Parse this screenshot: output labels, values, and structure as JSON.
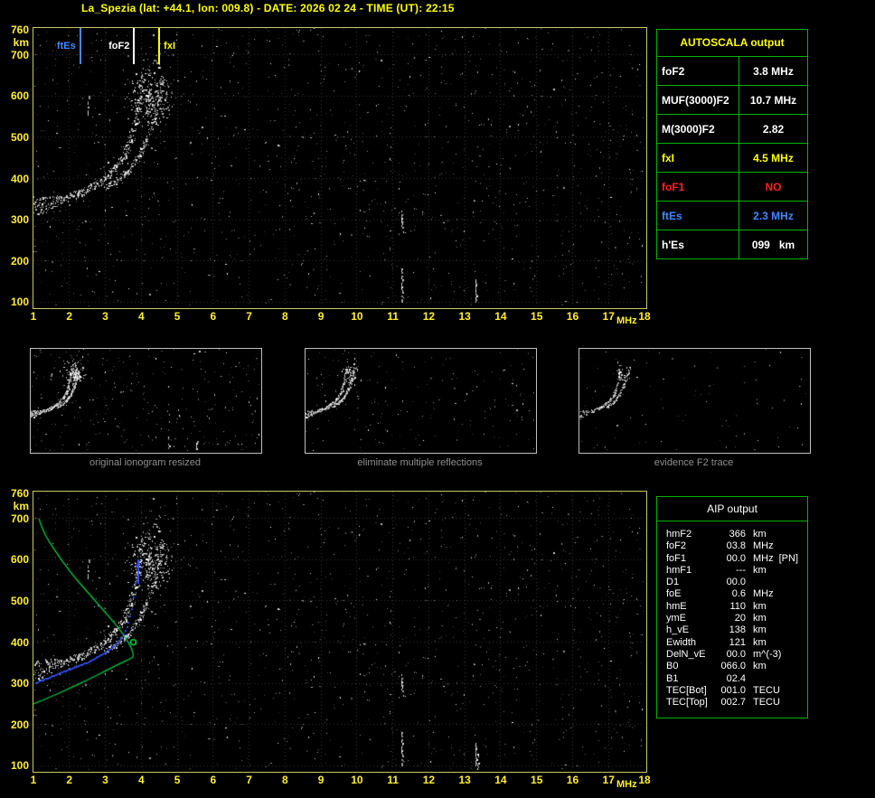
{
  "header": {
    "title": "La_Spezia (lat: +44.1, lon: 009.8) - DATE: 2026 02 24 - TIME (UT): 22:15"
  },
  "colors": {
    "title_text": "#ffff00",
    "plot_border": "#c9c960",
    "axis_text": "#ffee33",
    "grid": "#3a3a3a",
    "panel_border": "#00b400",
    "autoscala_header": "#ffff00",
    "caption_text": "#8f8f8f",
    "profile_green": "#00cc44",
    "restored_blue": "#2e4be8",
    "hmF2_marker_green": "#00ff55",
    "foF2_tick_blue": "#3355ff"
  },
  "autoscala": {
    "header": "AUTOSCALA output",
    "rows": [
      {
        "label": "foF2",
        "value": "3.8 MHz",
        "color": "#ffffff"
      },
      {
        "label": "MUF(3000)F2",
        "value": "10.7 MHz",
        "color": "#ffffff"
      },
      {
        "label": "M(3000)F2",
        "value": "2.82",
        "color": "#ffffff"
      },
      {
        "label": "fxI",
        "value": "4.5 MHz",
        "color": "#ffff00"
      },
      {
        "label": "foF1",
        "value": "NO",
        "color": "#ff2222"
      },
      {
        "label": "ftEs",
        "value": "2.3 MHz",
        "color": "#4488ff"
      },
      {
        "label": "h'Es",
        "value": "099   km",
        "color": "#ffffff"
      }
    ]
  },
  "thumbnails": [
    {
      "caption": "original ionogram resized"
    },
    {
      "caption": "eliminate multiple reflections"
    },
    {
      "caption": "evidence F2 trace"
    }
  ],
  "aip": {
    "header": "AIP output",
    "rows": [
      {
        "label": "hmF2",
        "value": "366",
        "unit": "km",
        "extra": ""
      },
      {
        "label": "foF2",
        "value": "03.8",
        "unit": "MHz",
        "extra": ""
      },
      {
        "label": "foF1",
        "value": "00.0",
        "unit": "MHz",
        "extra": "[PN]"
      },
      {
        "label": "hmF1",
        "value": "---",
        "unit": "km",
        "extra": ""
      },
      {
        "label": "D1",
        "value": "00.0",
        "unit": "",
        "extra": ""
      },
      {
        "label": "foE",
        "value": "0.6",
        "unit": "MHz",
        "extra": ""
      },
      {
        "label": "hmE",
        "value": "110",
        "unit": "km",
        "extra": ""
      },
      {
        "label": "ymE",
        "value": "20",
        "unit": "km",
        "extra": ""
      },
      {
        "label": "h_vE",
        "value": "138",
        "unit": "km",
        "extra": ""
      },
      {
        "label": "Ewidth",
        "value": "121",
        "unit": "km",
        "extra": ""
      },
      {
        "label": "DelN_vE",
        "value": "00.0",
        "unit": "m^(-3)",
        "extra": ""
      },
      {
        "label": "B0",
        "value": "066.0",
        "unit": "km",
        "extra": ""
      },
      {
        "label": "B1",
        "value": "02.4",
        "unit": "",
        "extra": ""
      },
      {
        "label": "TEC[Bot]",
        "value": "001.0",
        "unit": "TECU",
        "extra": ""
      },
      {
        "label": "TEC[Top]",
        "value": "002.7",
        "unit": "TECU",
        "extra": ""
      }
    ]
  },
  "chart_data": {
    "type": "scatter",
    "title": "Ionogram La_Spezia 2026-02-24 22:15 UT",
    "xlabel": "MHz",
    "ylabel": "km",
    "xlim": [
      1,
      18
    ],
    "ylim": [
      90,
      765
    ],
    "grid": true,
    "x_ticks": [
      1,
      2,
      3,
      4,
      5,
      6,
      7,
      8,
      9,
      10,
      11,
      12,
      13,
      14,
      15,
      16,
      17,
      18
    ],
    "y_ticks": [
      760,
      700,
      600,
      500,
      400,
      300,
      200,
      100
    ],
    "markers": [
      {
        "label": "ftEs",
        "freq_mhz": 2.3,
        "color": "#4488ff",
        "label_side": "left"
      },
      {
        "label": "foF2",
        "freq_mhz": 3.8,
        "color": "#ffffff",
        "label_side": "left"
      },
      {
        "label": "fxI",
        "freq_mhz": 4.5,
        "color": "#ffff00",
        "label_side": "right"
      }
    ],
    "o_trace": {
      "name": "F2 layer O-mode echo trace (f MHz, h' km)",
      "points": [
        [
          1.0,
          330
        ],
        [
          1.5,
          342
        ],
        [
          2.0,
          355
        ],
        [
          2.5,
          372
        ],
        [
          2.9,
          395
        ],
        [
          3.2,
          418
        ],
        [
          3.5,
          450
        ],
        [
          3.7,
          490
        ],
        [
          3.85,
          535
        ],
        [
          3.95,
          580
        ],
        [
          4.05,
          625
        ]
      ]
    },
    "x_trace": {
      "name": "F2 layer X-mode echo trace (f MHz, h' km)",
      "points": [
        [
          3.0,
          380
        ],
        [
          3.4,
          400
        ],
        [
          3.7,
          425
        ],
        [
          3.95,
          455
        ],
        [
          4.15,
          495
        ],
        [
          4.35,
          540
        ],
        [
          4.5,
          585
        ],
        [
          4.6,
          630
        ]
      ]
    },
    "multiples_cluster": {
      "name": "spread/multiple echoes near foF2",
      "center": [
        4.3,
        600
      ],
      "sigma": [
        0.3,
        40
      ]
    },
    "restored_trace": {
      "name": "AIP restored trace (blue)",
      "points": [
        [
          1.1,
          300
        ],
        [
          1.6,
          318
        ],
        [
          2.1,
          335
        ],
        [
          2.6,
          352
        ],
        [
          3.0,
          372
        ],
        [
          3.3,
          392
        ],
        [
          3.5,
          412
        ],
        [
          3.65,
          440
        ],
        [
          3.75,
          475
        ],
        [
          3.82,
          520
        ],
        [
          3.87,
          560
        ],
        [
          3.9,
          595
        ]
      ]
    },
    "density_profile": {
      "name": "electron density profile (green, plasma frequency MHz vs height km)",
      "points": [
        [
          1.0,
          250
        ],
        [
          1.5,
          268
        ],
        [
          2.0,
          288
        ],
        [
          2.5,
          308
        ],
        [
          3.0,
          330
        ],
        [
          3.4,
          348
        ],
        [
          3.7,
          360
        ],
        [
          3.8,
          366
        ],
        [
          3.7,
          392
        ],
        [
          3.4,
          432
        ],
        [
          3.0,
          472
        ],
        [
          2.5,
          522
        ],
        [
          2.0,
          572
        ],
        [
          1.6,
          622
        ],
        [
          1.3,
          662
        ],
        [
          1.15,
          700
        ]
      ]
    },
    "hmF2_marker": {
      "freq_mhz": 3.78,
      "h_km": 400
    },
    "foF2_tick_blue": {
      "freq_mhz": 3.92,
      "h_km": [
        540,
        600
      ]
    },
    "rfi_streaks": [
      {
        "freq_mhz": 2.53,
        "h_km": [
          555,
          600
        ]
      },
      {
        "freq_mhz": 11.26,
        "h_km": [
          280,
          330
        ]
      },
      {
        "freq_mhz": 11.26,
        "h_km": [
          100,
          180
        ]
      },
      {
        "freq_mhz": 13.3,
        "h_km": [
          100,
          155
        ]
      },
      {
        "freq_mhz": 13.35,
        "h_km": [
          92,
          128
        ],
        "plot": "bottom"
      }
    ]
  }
}
